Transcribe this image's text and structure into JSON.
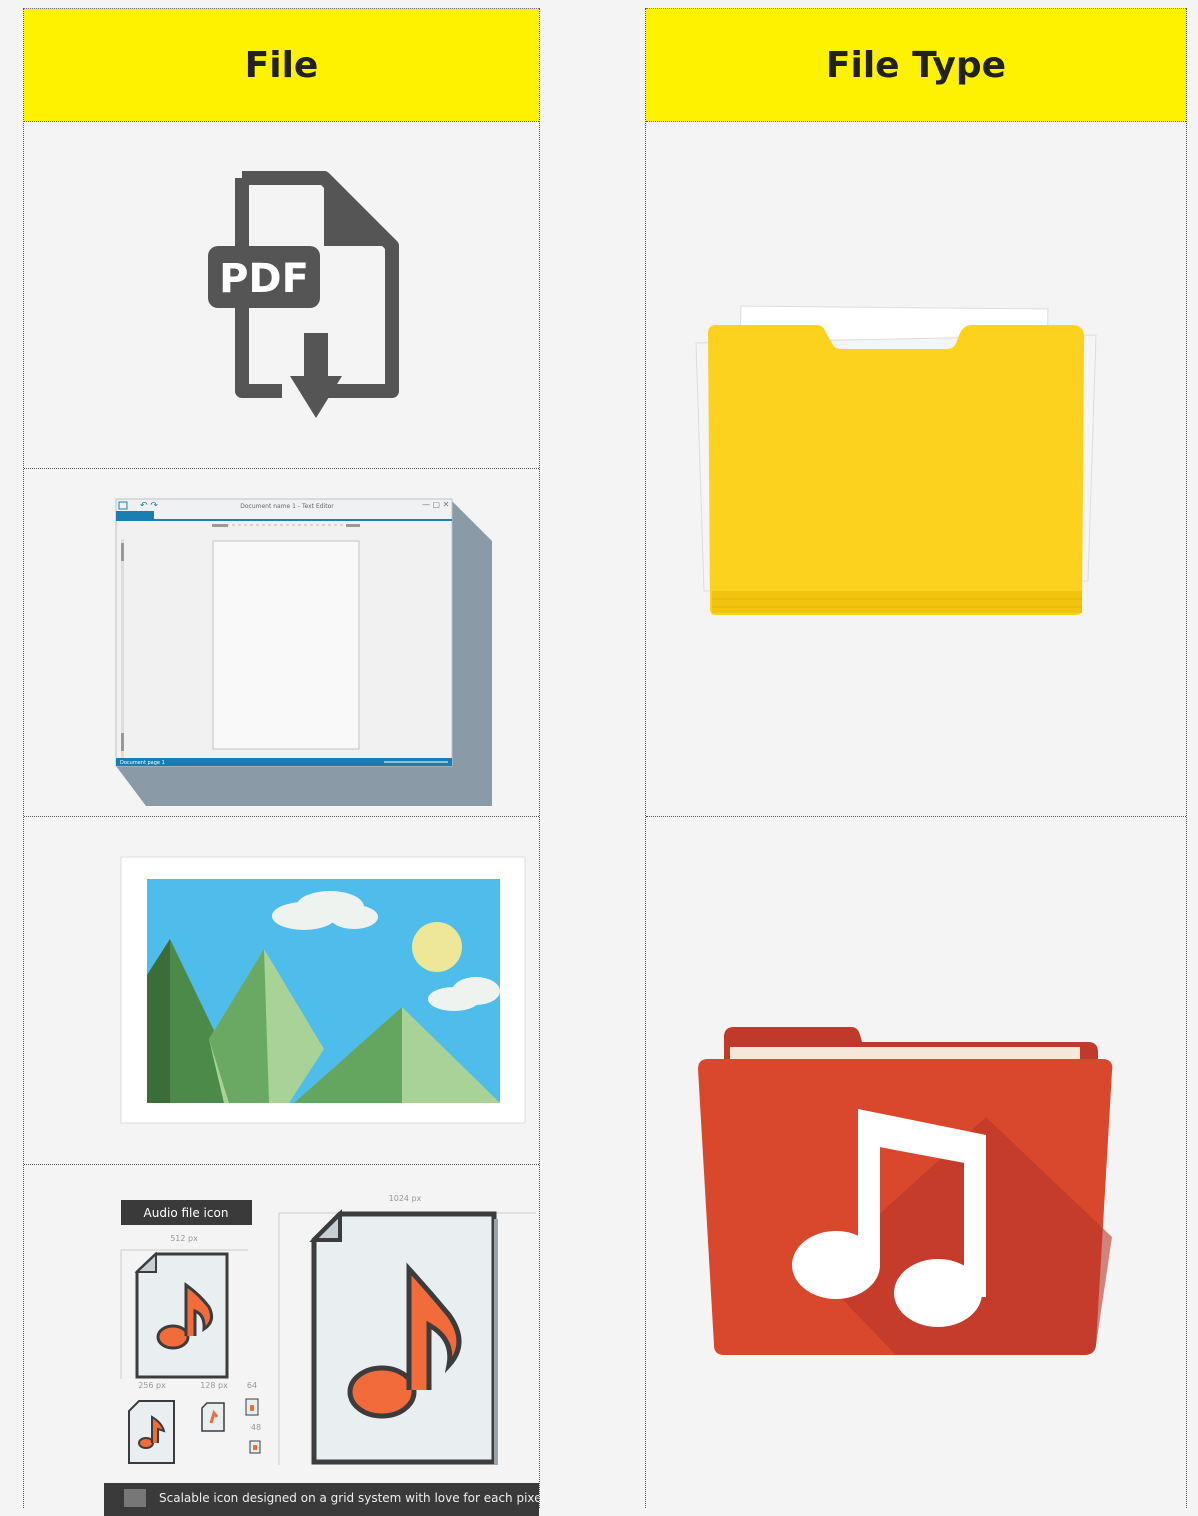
{
  "table": {
    "headers": [
      "File",
      "File Type"
    ]
  },
  "pdf_icon": {
    "badge_text": "PDF"
  },
  "text_editor": {
    "window_title": "Document name 1 - Text Editor",
    "status_text": "Document page 1"
  },
  "audio_sheet": {
    "title": "Audio file icon",
    "size_labels": [
      "1024 px",
      "512 px",
      "256 px",
      "128 px",
      "64",
      "48"
    ],
    "footer_text": "Scalable icon designed on a grid system with love for each pixel."
  },
  "colors": {
    "header_yellow": "#fff200",
    "folder_yellow": "#fcd21e",
    "folder_red": "#d9482c",
    "note_orange": "#f26b3a"
  }
}
